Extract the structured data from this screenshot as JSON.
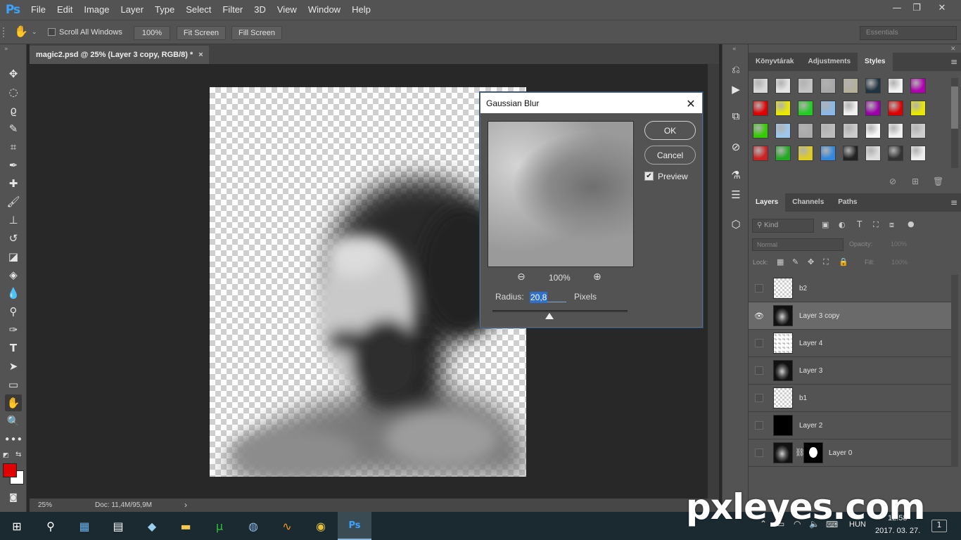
{
  "app": {
    "logo": "Ps",
    "menu": [
      "File",
      "Edit",
      "Image",
      "Layer",
      "Type",
      "Select",
      "Filter",
      "3D",
      "View",
      "Window",
      "Help"
    ],
    "window_controls": {
      "minimize": "—",
      "restore": "❐",
      "close": "✕"
    }
  },
  "options_bar": {
    "scroll_all_windows": "Scroll All Windows",
    "zoom_button": "100%",
    "fit_screen": "Fit Screen",
    "fill_screen": "Fill Screen",
    "workspace": "Essentials"
  },
  "document": {
    "tab_title": "magic2.psd @ 25% (Layer 3 copy, RGB/8) *",
    "tab_close": "×",
    "zoom": "25%",
    "doc_info": "Doc: 11,4M/95,9M",
    "status_arrow": "›"
  },
  "dialog": {
    "title": "Gaussian Blur",
    "close": "✕",
    "ok": "OK",
    "cancel": "Cancel",
    "preview_label": "Preview",
    "preview_checked": true,
    "preview_zoom": "100%",
    "radius_label": "Radius:",
    "radius_value": "20,8",
    "radius_unit": "Pixels",
    "radius_slider_fraction": 0.42
  },
  "panels": {
    "top_tabs": [
      "Könyvtárak",
      "Adjustments",
      "Styles"
    ],
    "top_active": "Styles",
    "layer_tabs": [
      "Layers",
      "Channels",
      "Paths"
    ],
    "layer_active": "Layers",
    "filter_placeholder": "Kind",
    "blend_mode": "Normal",
    "opacity_label": "Opacity:",
    "opacity_value": "100%",
    "lock_label": "Lock:",
    "fill_label": "Fill:",
    "fill_value": "100%",
    "layers": [
      {
        "name": "b2",
        "visible": false,
        "selected": false,
        "thumb": "transparent"
      },
      {
        "name": "Layer 3 copy",
        "visible": true,
        "selected": true,
        "thumb": "portrait"
      },
      {
        "name": "Layer 4",
        "visible": false,
        "selected": false,
        "thumb": "sketch"
      },
      {
        "name": "Layer 3",
        "visible": false,
        "selected": false,
        "thumb": "portrait"
      },
      {
        "name": "b1",
        "visible": false,
        "selected": false,
        "thumb": "transparent"
      },
      {
        "name": "Layer 2",
        "visible": false,
        "selected": false,
        "thumb": "black"
      },
      {
        "name": "Layer 0",
        "visible": false,
        "selected": false,
        "thumb": "portrait-mask"
      }
    ]
  },
  "styles_swatches": [
    [
      "#d8d8d8",
      "#e4e4e4",
      "#c4c4c4",
      "#a8a8a8",
      "#b5b09a",
      "#1f3340",
      "#f2f2f2",
      "#b000b0"
    ],
    [
      "#e00000",
      "#e8e800",
      "#22cc22",
      "#8ab8e8",
      "#f0f0f0",
      "#9a00aa",
      "#dd0000",
      "#e8e800"
    ],
    [
      "#33cc00",
      "#9cc8ec",
      "#aaaaaa",
      "#bdbdbd",
      "#cccccc",
      "#f6f6f6",
      "#f0f0f0",
      "#cfcfcf"
    ],
    [
      "#cc2222",
      "#22aa22",
      "#ddcc22",
      "#3388dd",
      "#222222",
      "#dddddd",
      "#333333",
      "#eeeeee"
    ]
  ],
  "taskbar": {
    "language": "HUN",
    "time": "12:58",
    "date": "2017. 03. 27.",
    "notification_count": "1"
  },
  "watermark": "pxleyes.com",
  "colors": {
    "foreground": "#e00000",
    "background": "#ffffff",
    "accent": "#3aa3ff"
  }
}
